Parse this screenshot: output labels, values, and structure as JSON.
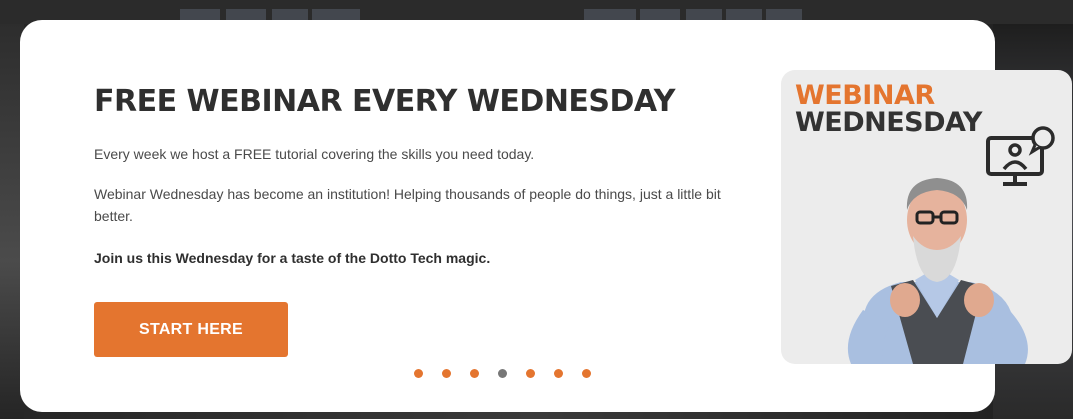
{
  "banner": {
    "title": "FREE WEBINAR EVERY WEDNESDAY",
    "paragraph1": "Every week we host a FREE tutorial covering the skills you need today.",
    "paragraph2": "Webinar Wednesday has become an institution! Helping thousands of people do things, just a little bit better.",
    "paragraph3": "Join us this Wednesday for a taste of the Dotto Tech magic.",
    "cta_label": "START HERE",
    "accent_color": "#e4752f"
  },
  "carousel": {
    "slide_count": 7,
    "active_index": 3,
    "active_dot_color": "#777777"
  },
  "promo_image": {
    "line1": "WEBINAR",
    "line2": "WEDNESDAY",
    "icon": "monitor-user-chat-icon"
  }
}
